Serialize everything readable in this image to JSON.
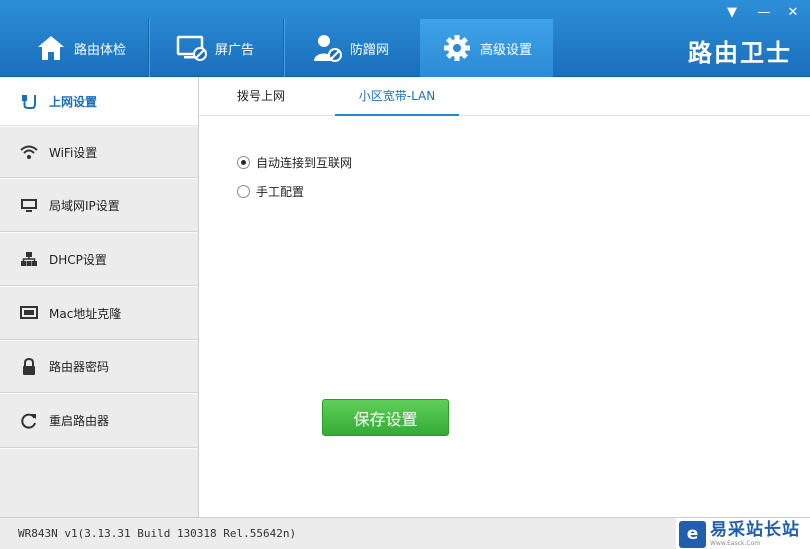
{
  "header": {
    "tabs": [
      {
        "label": "路由体检",
        "icon": "home-icon"
      },
      {
        "label": "屏广告",
        "icon": "screen-block-icon"
      },
      {
        "label": "防蹭网",
        "icon": "user-shield-icon"
      },
      {
        "label": "高级设置",
        "icon": "gear-icon",
        "active": true
      }
    ],
    "brand": "路由卫士",
    "window_controls": {
      "menu": "▼",
      "minimize": "—",
      "close": "✕"
    }
  },
  "sidebar": {
    "items": [
      {
        "label": "上网设置",
        "icon": "network-plug-icon",
        "active": true
      },
      {
        "label": "WiFi设置",
        "icon": "wifi-icon"
      },
      {
        "label": "局域网IP设置",
        "icon": "ip-monitor-icon"
      },
      {
        "label": "DHCP设置",
        "icon": "network-tree-icon"
      },
      {
        "label": "Mac地址克隆",
        "icon": "network-card-icon"
      },
      {
        "label": "路由器密码",
        "icon": "lock-icon"
      },
      {
        "label": "重启路由器",
        "icon": "restart-icon"
      }
    ]
  },
  "main": {
    "subtabs": [
      {
        "label": "拨号上网"
      },
      {
        "label": "小区宽带-LAN",
        "active": true
      }
    ],
    "options": [
      {
        "label": "自动连接到互联网",
        "selected": true
      },
      {
        "label": "手工配置",
        "selected": false
      }
    ],
    "save_label": "保存设置"
  },
  "status": {
    "version": "WR843N v1(3.13.31 Build 130318 Rel.55642n)"
  },
  "watermark": {
    "logo_letter": "e",
    "title": "易采站长站",
    "url": "Www.Easck.Com"
  },
  "colors": {
    "header_blue": "#1a6fbc",
    "accent_blue": "#2b86d3",
    "save_green": "#35aa34"
  }
}
